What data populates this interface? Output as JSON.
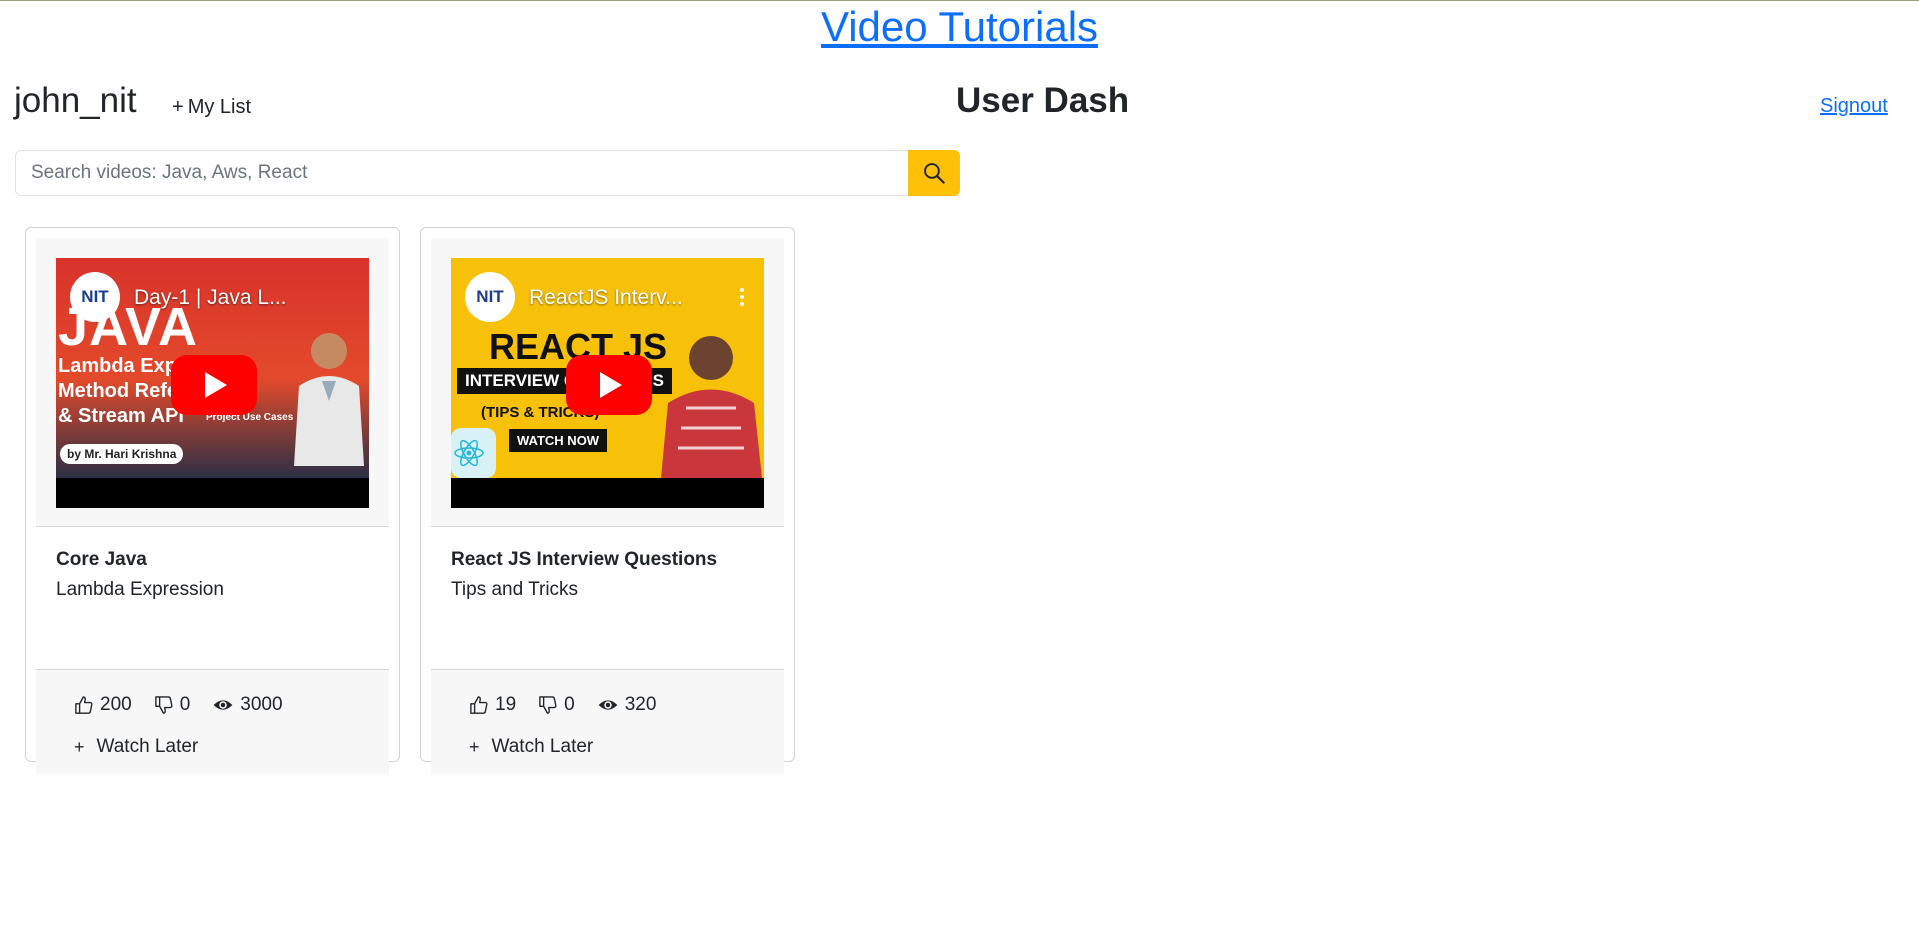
{
  "header": {
    "site_title": "Video Tutorials",
    "username": "john_nit",
    "my_list_label": "My List",
    "page_heading": "User Dash",
    "signout_label": "Signout"
  },
  "search": {
    "placeholder": "Search videos: Java, Aws, React",
    "value": "",
    "button_color": "#ffc107"
  },
  "videos": [
    {
      "yt_title": "Day-1 | Java L...",
      "thumb_lines": [
        "JAVA",
        "Lambda Expression",
        "Method Reference",
        "& Stream API"
      ],
      "thumb_badge": "Project Use Cases",
      "thumb_credit": "by Mr. Hari Krishna",
      "title": "Core Java",
      "description": "Lambda Expression",
      "likes": "200",
      "dislikes": "0",
      "views": "3000",
      "watch_later_label": "Watch Later"
    },
    {
      "yt_title": "ReactJS Interv...",
      "thumb_lines": [
        "REACT JS",
        "INTERVIEW QUESTIONS",
        "(TIPS & TRICKS)",
        "WATCH NOW"
      ],
      "title": "React JS Interview Questions",
      "description": "Tips and Tricks",
      "likes": "19",
      "dislikes": "0",
      "views": "320",
      "watch_later_label": "Watch Later"
    }
  ],
  "icons": {
    "search": "search-icon",
    "like": "thumbs-up-icon",
    "dislike": "thumbs-down-icon",
    "views": "eye-icon",
    "add": "plus-icon",
    "play": "youtube-play-icon"
  },
  "colors": {
    "link": "#0d6efd",
    "accent": "#ffc107",
    "youtube_red": "#ff0000"
  }
}
